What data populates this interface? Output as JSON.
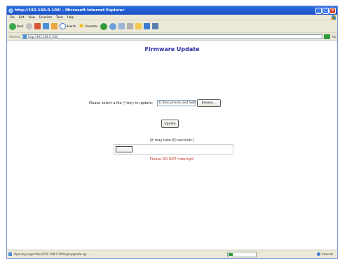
{
  "window": {
    "title": "http://192.168.0.100/ - Microsoft Internet Explorer",
    "minimize_label": "_",
    "maximize_label": "□",
    "close_label": "×"
  },
  "menubar": {
    "items": [
      "File",
      "Edit",
      "View",
      "Favorites",
      "Tools",
      "Help"
    ]
  },
  "toolbar": {
    "back_label": "Back",
    "search_label": "Search",
    "favorites_label": "Favorites"
  },
  "address": {
    "label": "Address",
    "value": "http://192.168.0.100/",
    "go_label": "Go"
  },
  "page": {
    "heading": "Firmware Update",
    "prompt": "Please select a file (*.bin) to update:",
    "file_value": "E:\\Documents and Settin",
    "browse_label": "Browse...",
    "update_label": "Update",
    "note": "(It may take 60 seconds.)",
    "warning": "Please DO NOT interrupt!"
  },
  "statusbar": {
    "text": "Opening page http://192.168.0.100/cgi/upgrade.cgi...",
    "zone": "Internet",
    "progress": 0.15
  },
  "colors": {
    "heading": "#2a2aa6",
    "warning": "#c0392b",
    "titlebar": "#1a4fc6"
  }
}
